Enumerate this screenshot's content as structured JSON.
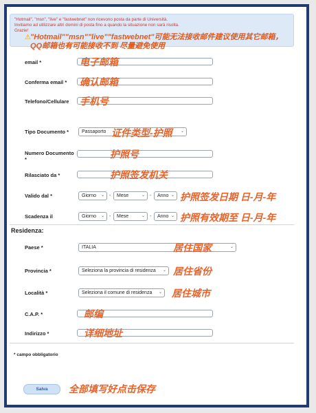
{
  "notice": {
    "line1": "\"Hotmail\", \"msn\", \"live\" e \"fastwebnet\" non ricevono posta da parte di Università.",
    "line2": "Invitiamo ad utilizzare altri domini di posta fino a quando la situazione non sarà risolta.",
    "line3": "Grazie!",
    "annotation": "\"Hotmail\"\"msn\"\"live\"\"fastwebnet\"可能无法接收邮件建议使用其它邮箱，QQ邮箱也有可能接收不到 尽量避免使用"
  },
  "fields": {
    "email": {
      "label": "email *",
      "annotation": "电子邮箱"
    },
    "confirm_email": {
      "label": "Conferma email *",
      "annotation": "确认邮箱"
    },
    "phone": {
      "label": "Telefono/Cellulare",
      "annotation": "手机号"
    },
    "doc_type": {
      "label": "Tipo Documento *",
      "value": "Passaporto",
      "annotation": "证件类型-护照"
    },
    "doc_number": {
      "label": "Numero Documento",
      "label_star": "*",
      "annotation": "护照号"
    },
    "issued_by": {
      "label": "Rilasciato da *",
      "annotation": "护照签发机关"
    },
    "valid_from": {
      "label": "Valido dal *",
      "day": "Giorno",
      "month": "Mese",
      "year": "Anno",
      "annotation": "护照签发日期 日-月-年"
    },
    "expiry": {
      "label": "Scadenza il",
      "day": "Giorno",
      "month": "Mese",
      "year": "Anno",
      "annotation": "护照有效期至 日-月-年"
    }
  },
  "residence": {
    "title": "Residenza:",
    "country": {
      "label": "Paese *",
      "value": "ITALIA",
      "annotation": "居住国家"
    },
    "province": {
      "label": "Provincia *",
      "value": "Seleziona la provincia di residenza",
      "annotation": "居住省份"
    },
    "city": {
      "label": "Località *",
      "value": "Seleziona il comune di residenza",
      "annotation": "居住城市"
    },
    "cap": {
      "label": "C.A.P. *",
      "annotation": "邮编"
    },
    "address": {
      "label": "Indirizzo *",
      "annotation": "详细地址"
    }
  },
  "required_note": "* campo obbligatorio",
  "save": {
    "label": "Salva",
    "annotation": "全部填写好点击保存"
  }
}
